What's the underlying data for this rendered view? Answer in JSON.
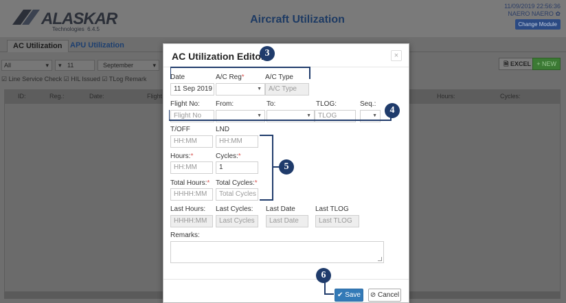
{
  "header": {
    "logo_text": "ALASKAR",
    "logo_sub": "Technologies",
    "logo_version": "6.4.5",
    "app_title": "Aircraft Utilization",
    "datetime": "11/09/2019 22:56:36",
    "user": "NAERO NAERO",
    "change_module": "Change Module"
  },
  "tabs": [
    "AC Utilization",
    "APU Utilization"
  ],
  "filters": {
    "all": "All",
    "day": "11",
    "month": "September"
  },
  "buttons": {
    "excel": "EXCEL",
    "new": "+ NEW"
  },
  "checks": "Line Service Check ☑ HIL Issued ☑ TLog Remark",
  "grid_columns": [
    "ID:",
    "Reg.:",
    "Date:",
    "Flight",
    "Hours:",
    "Cycles:"
  ],
  "modal": {
    "title": "AC Utilization Editor",
    "close": "×",
    "date": {
      "label": "Date",
      "value": "11 Sep 2019"
    },
    "ac_reg": {
      "label": "A/C Reg",
      "required_mark": "*"
    },
    "ac_type": {
      "label": "A/C Type",
      "placeholder": "A/C Type"
    },
    "flight_no": {
      "label": "Flight No:",
      "placeholder": "Flight No"
    },
    "from": {
      "label": "From:"
    },
    "to": {
      "label": "To:"
    },
    "tlog": {
      "label": "TLOG:",
      "placeholder": "TLOG"
    },
    "seq": {
      "label": "Seq.:"
    },
    "toff": {
      "label": "T/OFF",
      "placeholder": "HH:MM"
    },
    "lnd": {
      "label": "LND",
      "placeholder": "HH:MM"
    },
    "hours": {
      "label": "Hours:",
      "required_mark": "*",
      "placeholder": "HH:MM"
    },
    "cycles": {
      "label": "Cycles:",
      "required_mark": "*",
      "value": "1"
    },
    "total_hours": {
      "label": "Total Hours:",
      "required_mark": "*",
      "placeholder": "HHHH:MM"
    },
    "total_cycles": {
      "label": "Total Cycles:",
      "required_mark": "*",
      "placeholder": "Total Cycles"
    },
    "last_hours": {
      "label": "Last Hours:",
      "placeholder": "HHHH:MM"
    },
    "last_cycles": {
      "label": "Last Cycles:",
      "placeholder": "Last Cycles"
    },
    "last_date": {
      "label": "Last Date",
      "placeholder": "Last Date"
    },
    "last_tlog": {
      "label": "Last TLOG",
      "placeholder": "Last TLOG"
    },
    "remarks": {
      "label": "Remarks:"
    },
    "save": "Save",
    "cancel": "Cancel"
  },
  "callouts": [
    "3",
    "4",
    "5",
    "6"
  ],
  "colors": {
    "callout": "#1f3b6b",
    "save": "#337ab7",
    "new": "#3c7a34",
    "title": "#1d3a63"
  }
}
